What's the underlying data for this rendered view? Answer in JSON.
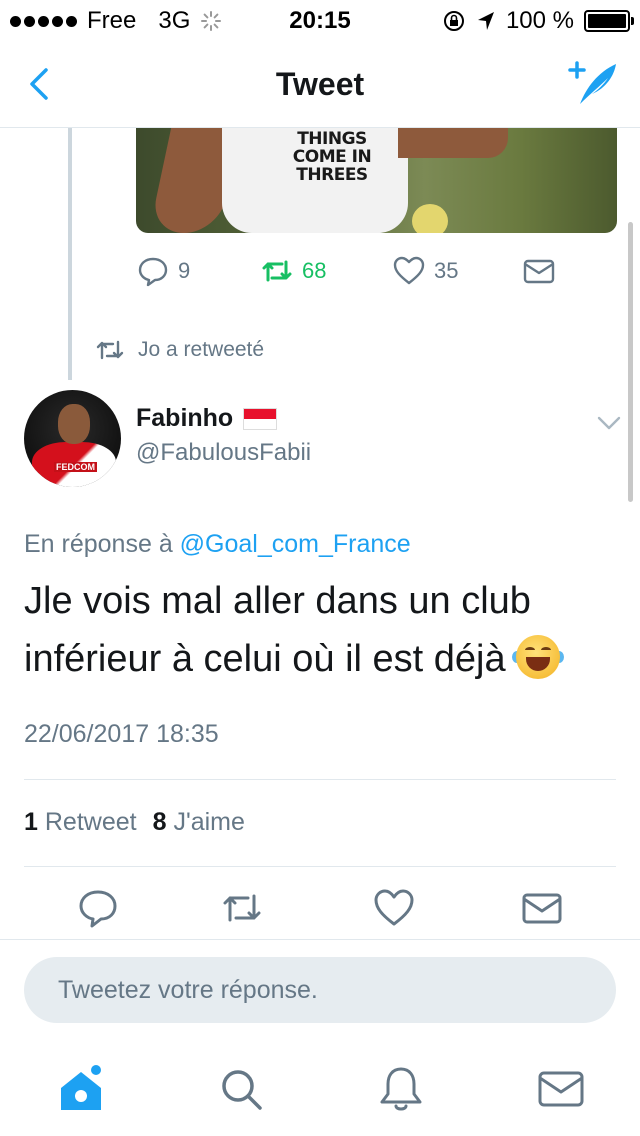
{
  "status_bar": {
    "carrier": "Free",
    "network": "3G",
    "time": "20:15",
    "battery": "100 %"
  },
  "nav": {
    "title": "Tweet",
    "back_icon": "chevron-left-icon",
    "compose_icon": "compose-tweet-icon"
  },
  "quoted_image": {
    "shirt_text": "THINGS COME IN THREES"
  },
  "prev_tweet_actions": {
    "replies": "9",
    "retweets": "68",
    "likes": "35"
  },
  "retweeted_by": "Jo a retweeté",
  "tweet": {
    "author_name": "Fabinho",
    "author_handle": "@FabulousFabii",
    "reply_prefix": "En réponse à",
    "reply_mention": "@Goal_com_France",
    "text": "Jle vois mal aller dans un club inférieur à celui où il est déjà",
    "timestamp": "22/06/2017 18:35",
    "retweet_count": "1",
    "retweet_label": "Retweet",
    "like_count": "8",
    "like_label": "J'aime"
  },
  "reply_input": {
    "placeholder": "Tweetez votre réponse."
  },
  "colors": {
    "accent": "#1da1f2",
    "retweet_green": "#17bf63",
    "muted": "#657786"
  }
}
